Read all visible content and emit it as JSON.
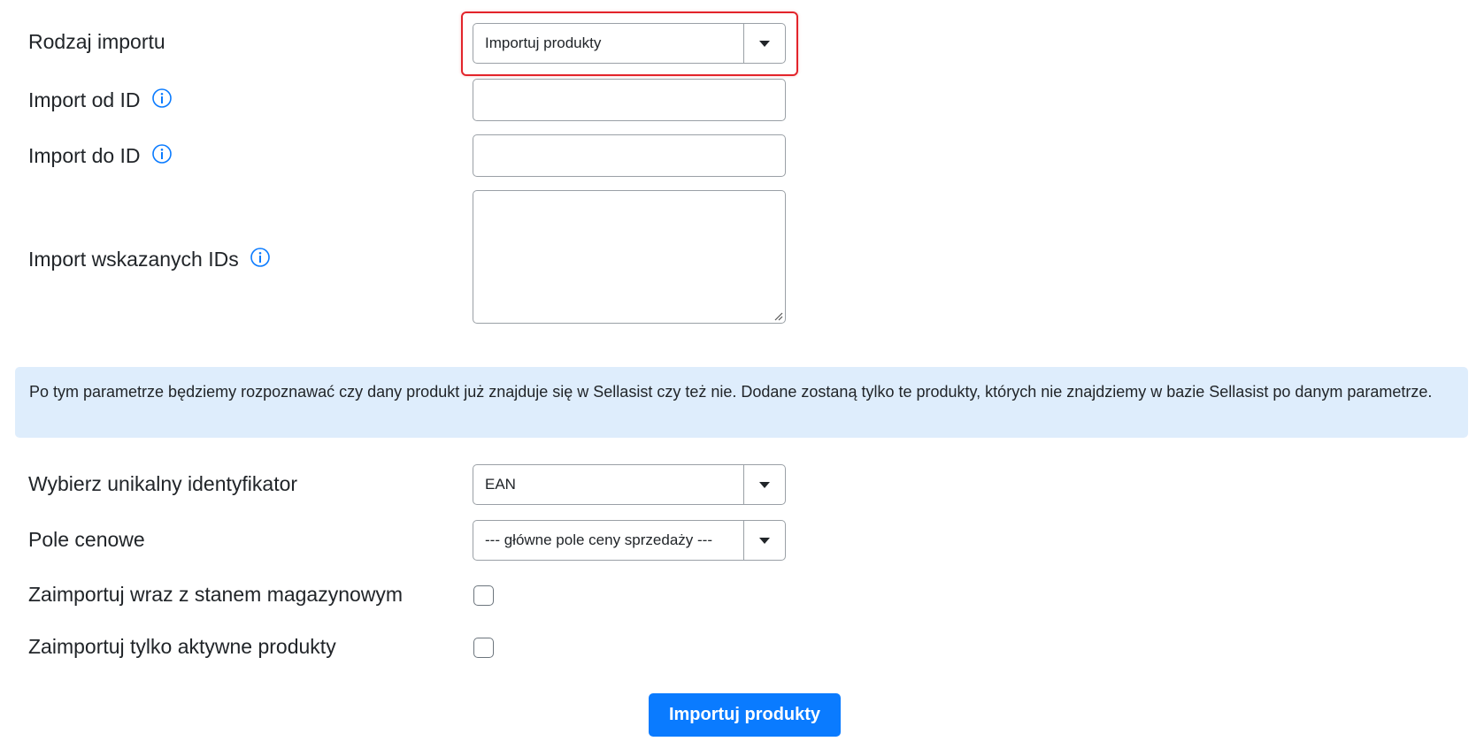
{
  "form": {
    "import_type": {
      "label": "Rodzaj importu",
      "selected": "Importuj produkty"
    },
    "import_from_id": {
      "label": "Import od ID",
      "value": ""
    },
    "import_to_id": {
      "label": "Import do ID",
      "value": ""
    },
    "import_ids": {
      "label": "Import wskazanych IDs",
      "value": ""
    },
    "info_message": "Po tym parametrze będziemy rozpoznawać czy dany produkt już znajduje się w Sellasist czy też nie. Dodane zostaną tylko te produkty, których nie znajdziemy w bazie Sellasist po danym parametrze.",
    "unique_identifier": {
      "label": "Wybierz unikalny identyfikator",
      "selected": "EAN"
    },
    "price_field": {
      "label": "Pole cenowe",
      "selected": "--- główne pole ceny sprzedaży ---"
    },
    "import_with_stock": {
      "label": "Zaimportuj wraz z stanem magazynowym",
      "checked": false
    },
    "import_only_active": {
      "label": "Zaimportuj tylko aktywne produkty",
      "checked": false
    },
    "submit_label": "Importuj produkty"
  },
  "icons": {
    "info": "info-icon",
    "dropdown": "chevron-down-icon"
  },
  "colors": {
    "primary": "#0a7bff",
    "info_bg": "#deedfc",
    "highlight": "#e3242b",
    "info_icon": "#0a7bff"
  }
}
